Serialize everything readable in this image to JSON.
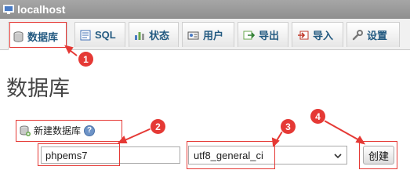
{
  "window": {
    "title": "localhost"
  },
  "tabs": [
    {
      "label": "数据库",
      "icon": "database-icon",
      "active": true
    },
    {
      "label": "SQL",
      "icon": "sql-icon"
    },
    {
      "label": "状态",
      "icon": "status-chart-icon"
    },
    {
      "label": "用户",
      "icon": "users-icon"
    },
    {
      "label": "导出",
      "icon": "export-icon"
    },
    {
      "label": "导入",
      "icon": "import-icon"
    },
    {
      "label": "设置",
      "icon": "wrench-icon"
    }
  ],
  "page": {
    "title": "数据库"
  },
  "create_form": {
    "heading": "新建数据库",
    "help_glyph": "?",
    "db_name_value": "phpems7",
    "collation_value": "utf8_general_ci",
    "create_label": "创建"
  },
  "annotations": {
    "color": "#e53935",
    "markers": [
      "1",
      "2",
      "3",
      "4"
    ]
  }
}
